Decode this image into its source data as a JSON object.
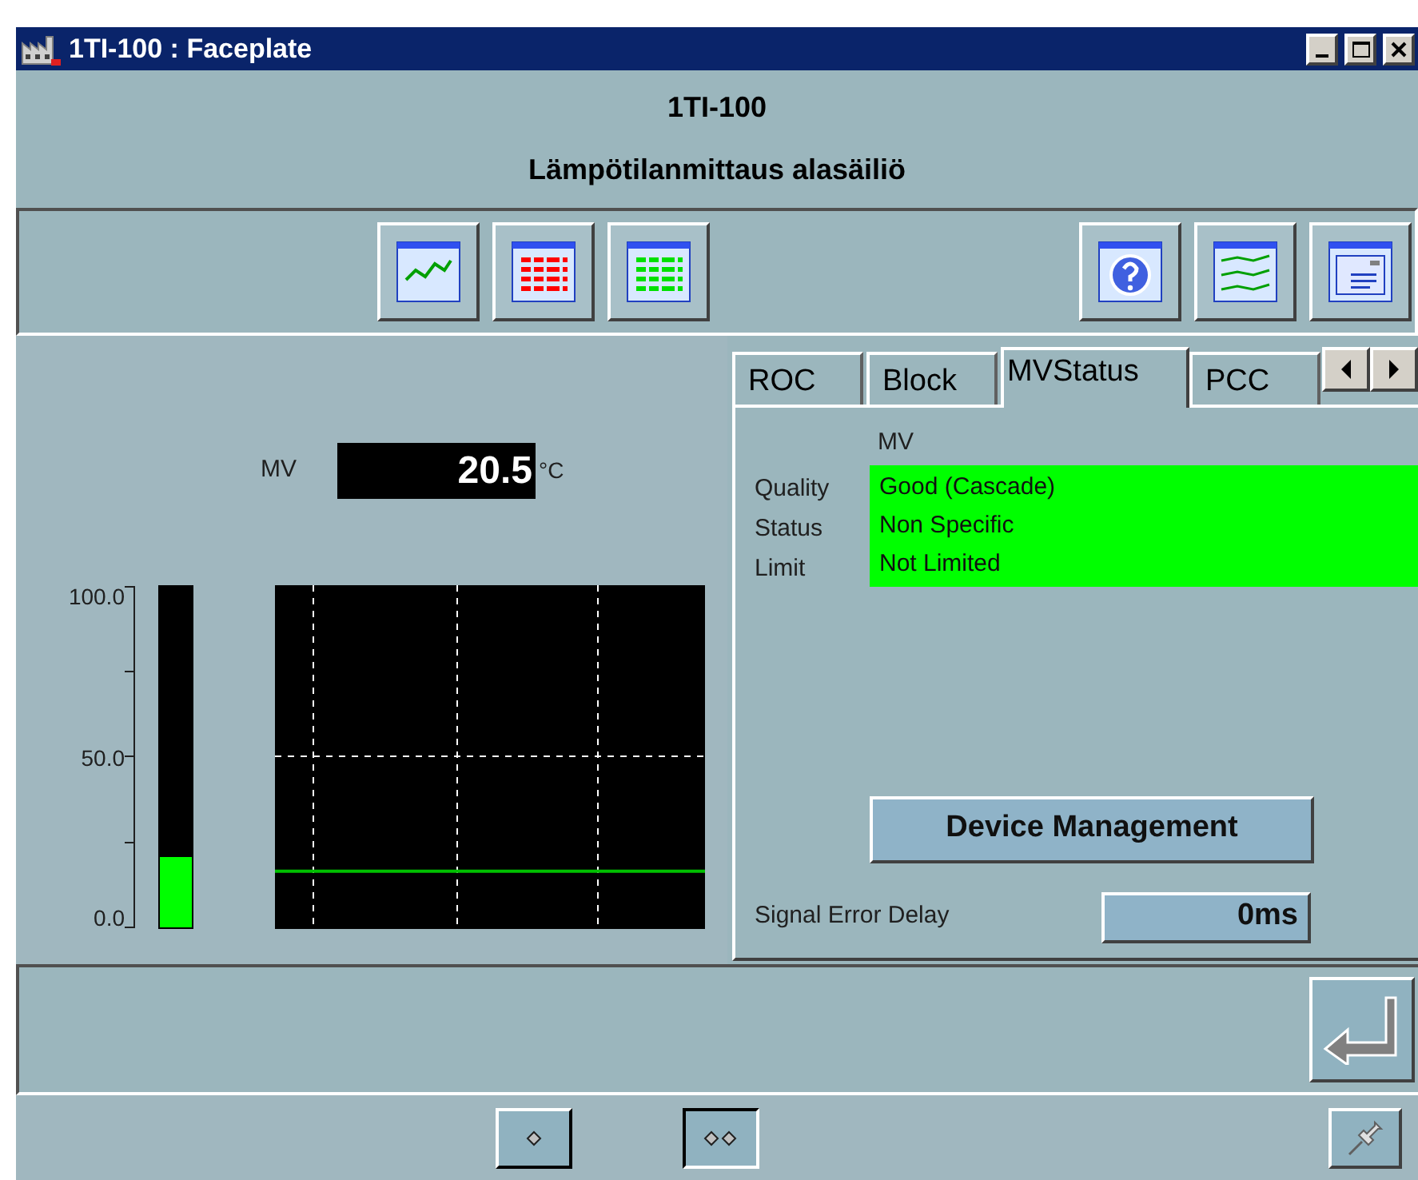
{
  "window": {
    "title": "1TI-100 : Faceplate"
  },
  "header": {
    "tag": "1TI-100",
    "description": "Lämpötilanmittaus alasäiliö"
  },
  "mv": {
    "label": "MV",
    "value": "20.5",
    "unit": "°C"
  },
  "bar_gauge": {
    "level": 0.205,
    "scale": [
      "100.0",
      "50.0",
      "0.0"
    ]
  },
  "tabs": [
    {
      "label": "ROC",
      "selected": false
    },
    {
      "label": "Block",
      "selected": false
    },
    {
      "label": "MVStatus",
      "selected": true
    },
    {
      "label": "PCC",
      "selected": false
    }
  ],
  "status": {
    "column": "MV",
    "rows": [
      {
        "label": "Quality",
        "value": "Good (Cascade)"
      },
      {
        "label": "Status",
        "value": "Non Specific"
      },
      {
        "label": "Limit",
        "value": "Not Limited"
      }
    ]
  },
  "device_button": "Device Management",
  "signal_error_delay": {
    "label": "Signal Error Delay",
    "value": "0ms"
  },
  "view_buttons": [
    {
      "kind": "single",
      "selected": false
    },
    {
      "kind": "double",
      "selected": true
    }
  ]
}
